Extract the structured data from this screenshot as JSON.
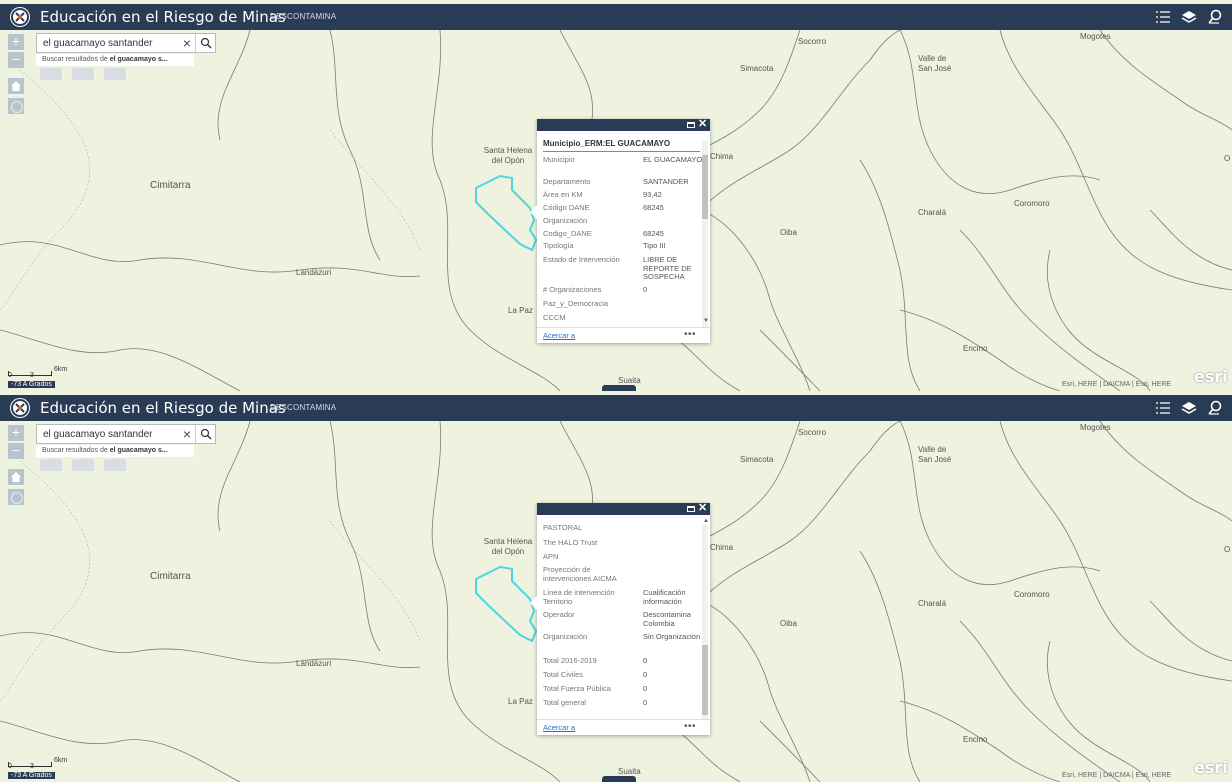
{
  "header": {
    "title": "Educación en el Riesgo de Minas",
    "subtitle": "DESCONTAMINA"
  },
  "search": {
    "value": "el guacamayo santander",
    "suggestion_prefix": "Buscar resultados de ",
    "suggestion_bold": "el guacamayo s..."
  },
  "map": {
    "places": {
      "socorro": "Socorro",
      "mogotes": "Mogotes",
      "valle": "Valle de\nSan José",
      "simacota": "Simacota",
      "santa_helena": "Santa Helena\ndel Opón",
      "chima": "Chima",
      "cimitarra": "Cimitarra",
      "charala": "Charalá",
      "coromoro": "Coromoro",
      "oiba": "Oiba",
      "landazuri": "Landázuri",
      "la_paz": "La Paz",
      "encino": "Encino",
      "suaita": "Suaita",
      "edge_o": "O"
    },
    "scale_label": "6km",
    "scale_zero": "0",
    "scale_mid": "3",
    "coords_text": "-73 A Grados",
    "attribution": "Esri, HERE | DAICMA | Esri, HERE",
    "esri_logo": "esri"
  },
  "popup_top": {
    "title": "Municipio_ERM:EL GUACAMAYO",
    "rows": [
      {
        "name": "Municipio",
        "value": "EL GUACAMAYO"
      },
      {
        "name": "Departamento",
        "value": "SANTANDER"
      },
      {
        "name": "Área en KM",
        "value": "93,42"
      },
      {
        "name": "Código DANE",
        "value": "68245"
      },
      {
        "name": "Organización",
        "value": ""
      },
      {
        "name": "Codigo_DANE",
        "value": "68245"
      },
      {
        "name": "Tipología",
        "value": "Tipo III"
      },
      {
        "name": "Estado de Intervención",
        "value": "LIBRE DE REPORTE DE SOSPECHA"
      },
      {
        "name": "# Organizaciones",
        "value": "0"
      },
      {
        "name": "Paz_y_Democracia",
        "value": ""
      },
      {
        "name": "CCCM",
        "value": ""
      }
    ],
    "zoom_link": "Acercar a",
    "more": "•••"
  },
  "popup_bottom": {
    "rows": [
      {
        "name": "PASTORAL",
        "value": ""
      },
      {
        "name": "The HALO Trust",
        "value": ""
      },
      {
        "name": "APN",
        "value": ""
      },
      {
        "name": "Proyección de intervenciones AICMA",
        "value": ""
      },
      {
        "name": "Línea de intervención Territorio",
        "value": "Cualificación información"
      },
      {
        "name": "Operador",
        "value": "Descontamina Colombia"
      },
      {
        "name": "Organización",
        "value": "Sin Organizacion"
      },
      {
        "name": "Total 2016-2019",
        "value": "0"
      },
      {
        "name": "Total Civiles",
        "value": "0"
      },
      {
        "name": "Total Fuerza Pública",
        "value": "0"
      },
      {
        "name": "Total general",
        "value": "0"
      }
    ],
    "zoom_link": "Acercar a",
    "more": "•••"
  },
  "colors": {
    "header_bg": "#2a3b55",
    "map_bg": "#eef2df",
    "highlight": "#4dd6e0",
    "link": "#2a6bc8"
  }
}
